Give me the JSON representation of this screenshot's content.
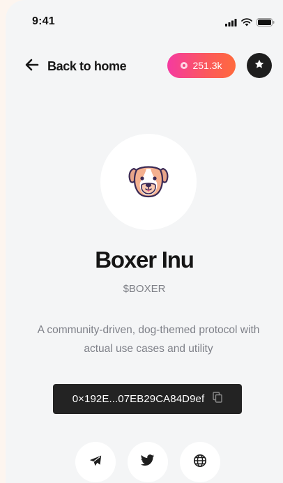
{
  "status_bar": {
    "time": "9:41"
  },
  "header": {
    "back_label": "Back to home",
    "balance": "251.3k"
  },
  "token": {
    "name": "Boxer Inu",
    "symbol": "$BOXER",
    "description": "A community-driven, dog-themed protocol with actual use cases and utility",
    "address": "0×192E...07EB29CA84D9ef"
  },
  "icons": {
    "back": "arrow-left-icon",
    "coin": "coin-icon",
    "favorite": "star-icon",
    "avatar": "dog-face-icon",
    "copy": "copy-icon",
    "telegram": "telegram-icon",
    "twitter": "twitter-icon",
    "website": "globe-icon"
  },
  "colors": {
    "balance_gradient_start": "#f53aa0",
    "balance_gradient_end": "#ff6a3d",
    "address_bg": "#232323",
    "background": "#f4f5f6"
  }
}
